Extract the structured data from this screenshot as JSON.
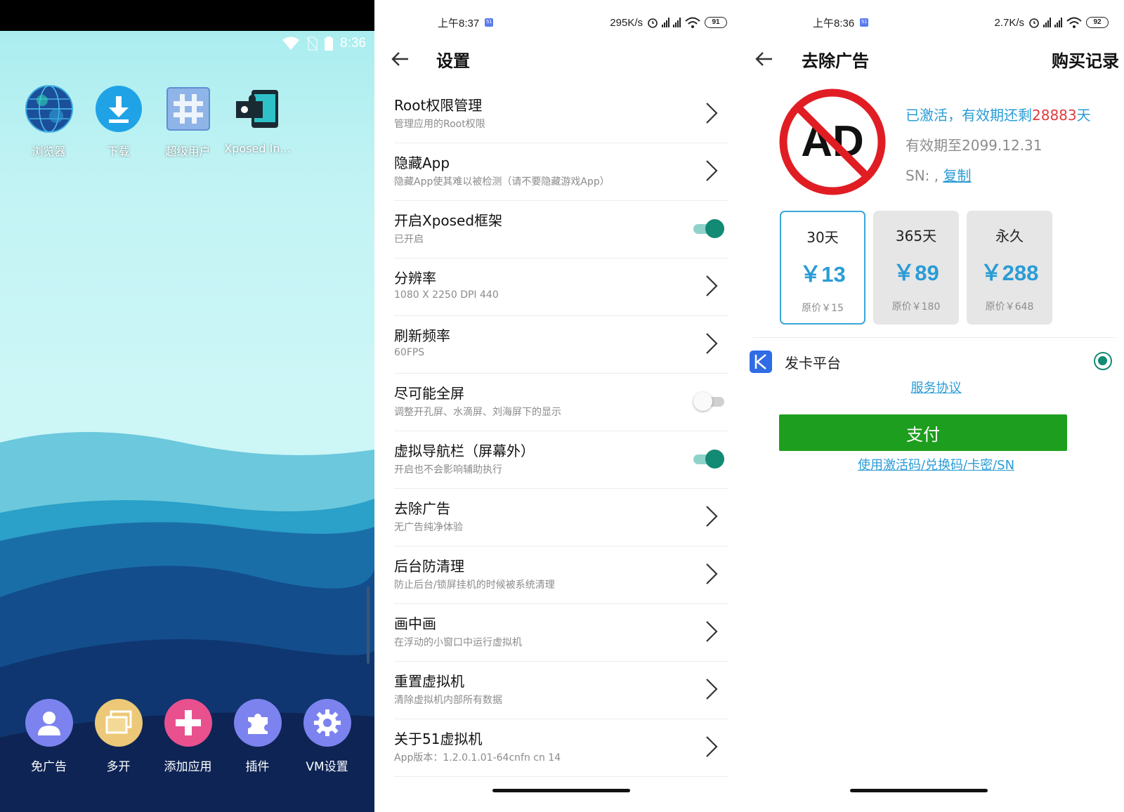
{
  "launcher": {
    "status_time": "8:36",
    "apps": [
      {
        "label": "浏览器",
        "icon": "globe-icon"
      },
      {
        "label": "下载",
        "icon": "download-icon"
      },
      {
        "label": "超级用户",
        "icon": "hash-icon"
      },
      {
        "label": "Xposed In...",
        "icon": "puzzle-phone-icon"
      }
    ],
    "dock": [
      {
        "label": "免广告",
        "icon": "user-icon",
        "color": "#7c83ef"
      },
      {
        "label": "多开",
        "icon": "windows-icon",
        "color": "#ecc878"
      },
      {
        "label": "添加应用",
        "icon": "plus-icon",
        "color": "#e8518e"
      },
      {
        "label": "插件",
        "icon": "puzzle-icon",
        "color": "#7c83ef"
      },
      {
        "label": "VM设置",
        "icon": "gear-icon",
        "color": "#7c83ef"
      }
    ]
  },
  "settings": {
    "status": {
      "time": "上午8:37",
      "speed": "295K/s",
      "battery": "91"
    },
    "title": "设置",
    "rows": [
      {
        "title": "Root权限管理",
        "subtitle": "管理应用的Root权限",
        "control": "chevron"
      },
      {
        "title": "隐藏App",
        "subtitle": "隐藏App使其难以被检测（请不要隐藏游戏App）",
        "control": "chevron"
      },
      {
        "title": "开启Xposed框架",
        "subtitle": "已开启",
        "control": "toggle-on"
      },
      {
        "title": "分辨率",
        "subtitle": "1080 X 2250 DPI 440",
        "control": "chevron"
      },
      {
        "title": "刷新频率",
        "subtitle": "60FPS",
        "control": "chevron"
      },
      {
        "title": "尽可能全屏",
        "subtitle": "调整开孔屏、水滴屏、刘海屏下的显示",
        "control": "toggle-off"
      },
      {
        "title": "虚拟导航栏（屏幕外）",
        "subtitle": "开启也不会影响辅助执行",
        "control": "toggle-on"
      },
      {
        "title": "去除广告",
        "subtitle": "无广告纯净体验",
        "control": "chevron"
      },
      {
        "title": "后台防清理",
        "subtitle": "防止后台/锁屏挂机的时候被系统清理",
        "control": "chevron"
      },
      {
        "title": "画中画",
        "subtitle": "在浮动的小窗口中运行虚拟机",
        "control": "chevron"
      },
      {
        "title": "重置虚拟机",
        "subtitle": "清除虚拟机内部所有数据",
        "control": "chevron"
      },
      {
        "title": "关于51虚拟机",
        "subtitle": "App版本：1.2.0.1.01-64cnfn cn 14",
        "control": "chevron"
      }
    ]
  },
  "remove_ads": {
    "status": {
      "time": "上午8:36",
      "speed": "2.7K/s",
      "battery": "92"
    },
    "title": "去除广告",
    "history_label": "购买记录",
    "logo_text": "AD",
    "activated_prefix": "已激活，有效期还剩",
    "days_left": "28883",
    "days_unit": "天",
    "expiry": "有效期至2099.12.31",
    "sn_prefix": "SN: ,",
    "copy_label": "复制",
    "plans": [
      {
        "name": "30天",
        "price": "￥13",
        "original": "原价￥15",
        "selected": true
      },
      {
        "name": "365天",
        "price": "￥89",
        "original": "原价￥180",
        "selected": false
      },
      {
        "name": "永久",
        "price": "￥288",
        "original": "原价￥648",
        "selected": false
      }
    ],
    "payment_method": "发卡平台",
    "service_agreement": "服务协议",
    "pay_button": "支付",
    "activation_link": "使用激活码/兑换码/卡密/SN",
    "accent": "#2a9cd6",
    "pay_color": "#1e9e1e"
  }
}
